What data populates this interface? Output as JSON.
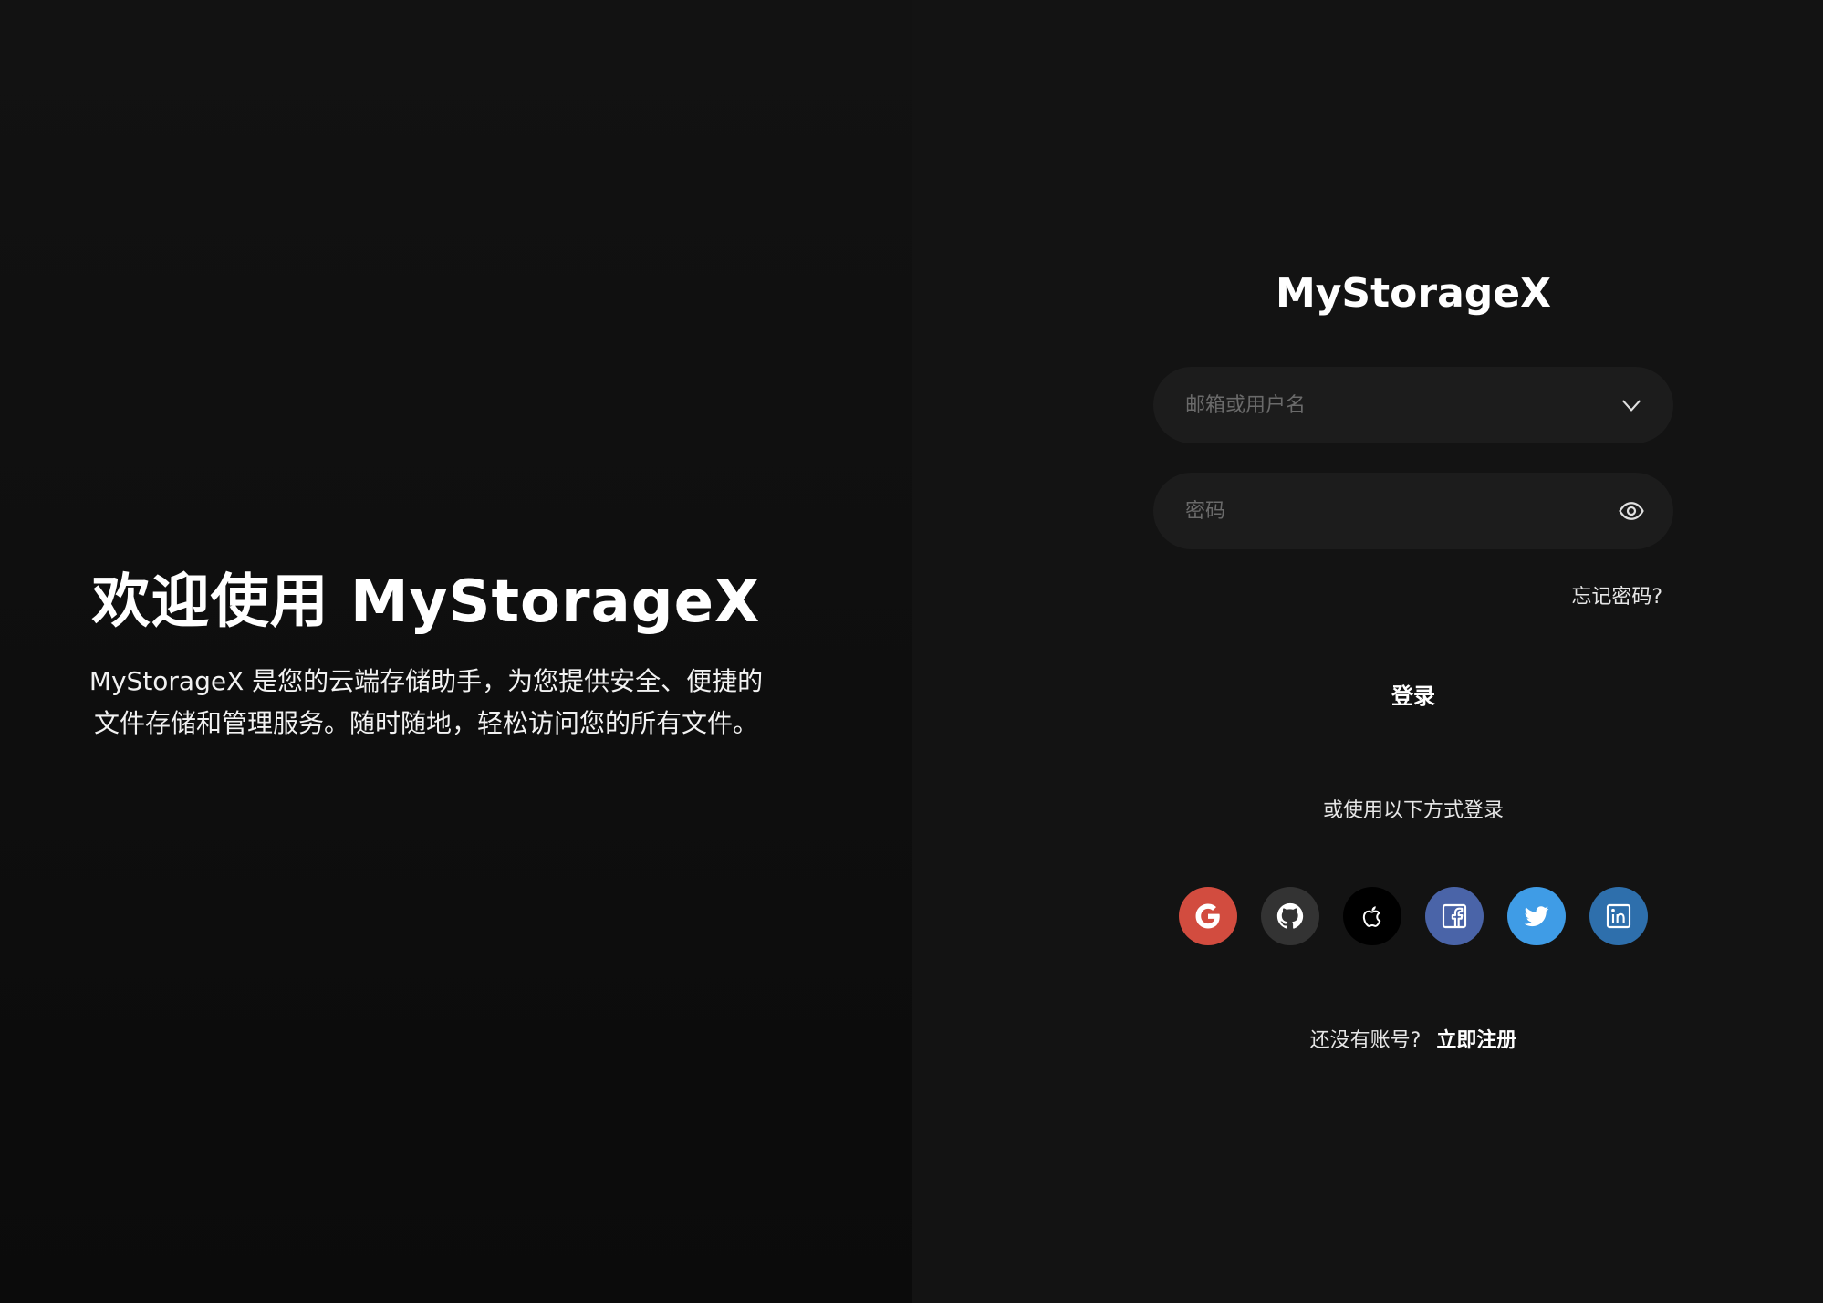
{
  "left": {
    "title": "欢迎使用 MyStorageX",
    "description": "MyStorageX 是您的云端存储助手，为您提供安全、便捷的文件存储和管理服务。随时随地，轻松访问您的所有文件。"
  },
  "login": {
    "brand": "MyStorageX",
    "username_placeholder": "邮箱或用户名",
    "password_placeholder": "密码",
    "forgot_label": "忘记密码?",
    "login_label": "登录",
    "alt_label": "或使用以下方式登录",
    "socials": [
      {
        "name": "google",
        "icon": "google-icon",
        "color": "#d24c3f"
      },
      {
        "name": "github",
        "icon": "github-icon",
        "color": "#333333"
      },
      {
        "name": "apple",
        "icon": "apple-icon",
        "color": "#000000"
      },
      {
        "name": "facebook",
        "icon": "facebook-icon",
        "color": "#4a64a8"
      },
      {
        "name": "twitter",
        "icon": "twitter-icon",
        "color": "#3f9ce6"
      },
      {
        "name": "linkedin",
        "icon": "linkedin-icon",
        "color": "#2e6fac"
      }
    ],
    "signup_prompt": "还没有账号?",
    "signup_link": "立即注册"
  }
}
